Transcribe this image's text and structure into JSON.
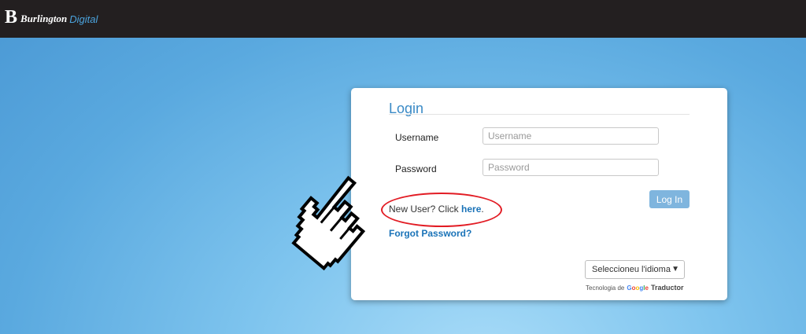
{
  "header": {
    "logo_mark": "B",
    "logo_text_main": "Burlington",
    "logo_text_accent": "Digital"
  },
  "login": {
    "title": "Login",
    "username_label": "Username",
    "username_placeholder": "Username",
    "username_value": "",
    "password_label": "Password",
    "password_placeholder": "Password",
    "password_value": "",
    "login_button": "Log In",
    "new_user_text": "New User? Click ",
    "new_user_link": "here",
    "new_user_period": ".",
    "forgot_password": "Forgot Password?"
  },
  "translate": {
    "select_value": "Seleccioneu l'idioma",
    "powered_prefix": "Tecnologia de",
    "google_letters": [
      "G",
      "o",
      "o",
      "g",
      "l",
      "e"
    ],
    "google_colors": [
      "#4285f4",
      "#ea4335",
      "#fbbc05",
      "#4285f4",
      "#34a853",
      "#ea4335"
    ],
    "powered_suffix": "Traductor"
  },
  "annotations": {
    "highlight_color": "#e21c24",
    "pointer": "hand-pointer-icon"
  }
}
